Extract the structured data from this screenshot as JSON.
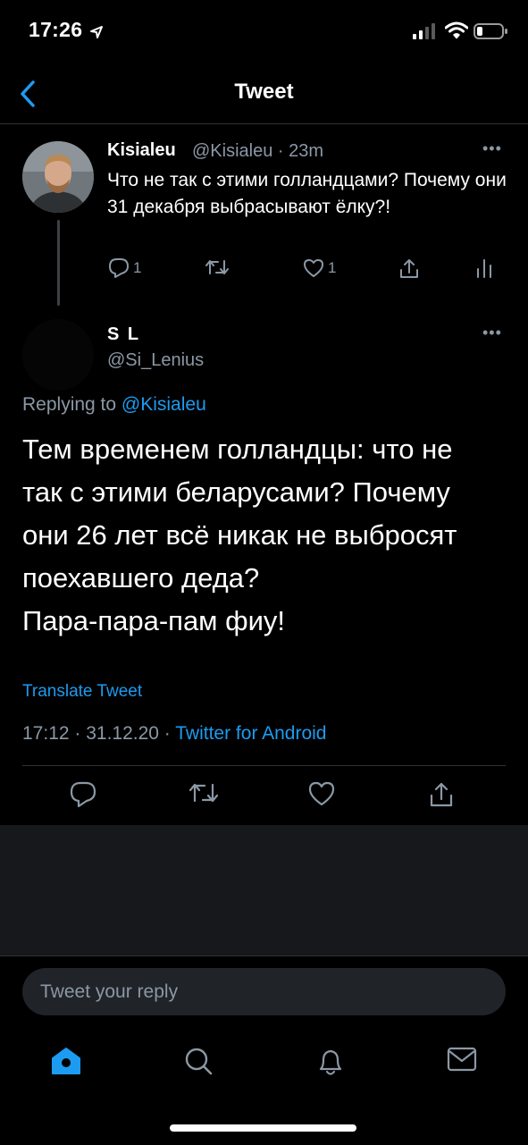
{
  "status_bar": {
    "time": "17:26"
  },
  "header": {
    "title": "Tweet"
  },
  "parent_tweet": {
    "name": "Kisialeu",
    "meta": "@Kisialeu · 23m",
    "more": "•••",
    "text": "Что не так с этими голландцами? Почему они 31 декабря выбрасывают ёлку?!",
    "reply_count": "1",
    "like_count": "1"
  },
  "reply_tweet": {
    "name": "S L",
    "handle": "@Si_Lenius",
    "more": "•••",
    "replying_prefix": "Replying to ",
    "replying_to": "@Kisialeu",
    "body_lines": [
      "Тем временем голландцы: что не",
      "так с этими беларусами? Почему",
      "они 26 лет всё никак не выбросят",
      "поехавшего деда?",
      "Пара-пара-пам фиу!"
    ],
    "translate": "Translate Tweet",
    "timestamp": "17:12 · 31.12.20 · ",
    "source": "Twitter for Android"
  },
  "reply_bar": {
    "placeholder": "Tweet your reply"
  },
  "colors": {
    "accent": "#1d9bf0",
    "muted": "#8b98a5",
    "divider": "#2f3336"
  },
  "icons": {
    "status": [
      "location-arrow-icon",
      "signal-icon",
      "wifi-icon",
      "battery-icon"
    ],
    "tabs": [
      "home-icon",
      "search-icon",
      "bell-icon",
      "mail-icon"
    ]
  }
}
